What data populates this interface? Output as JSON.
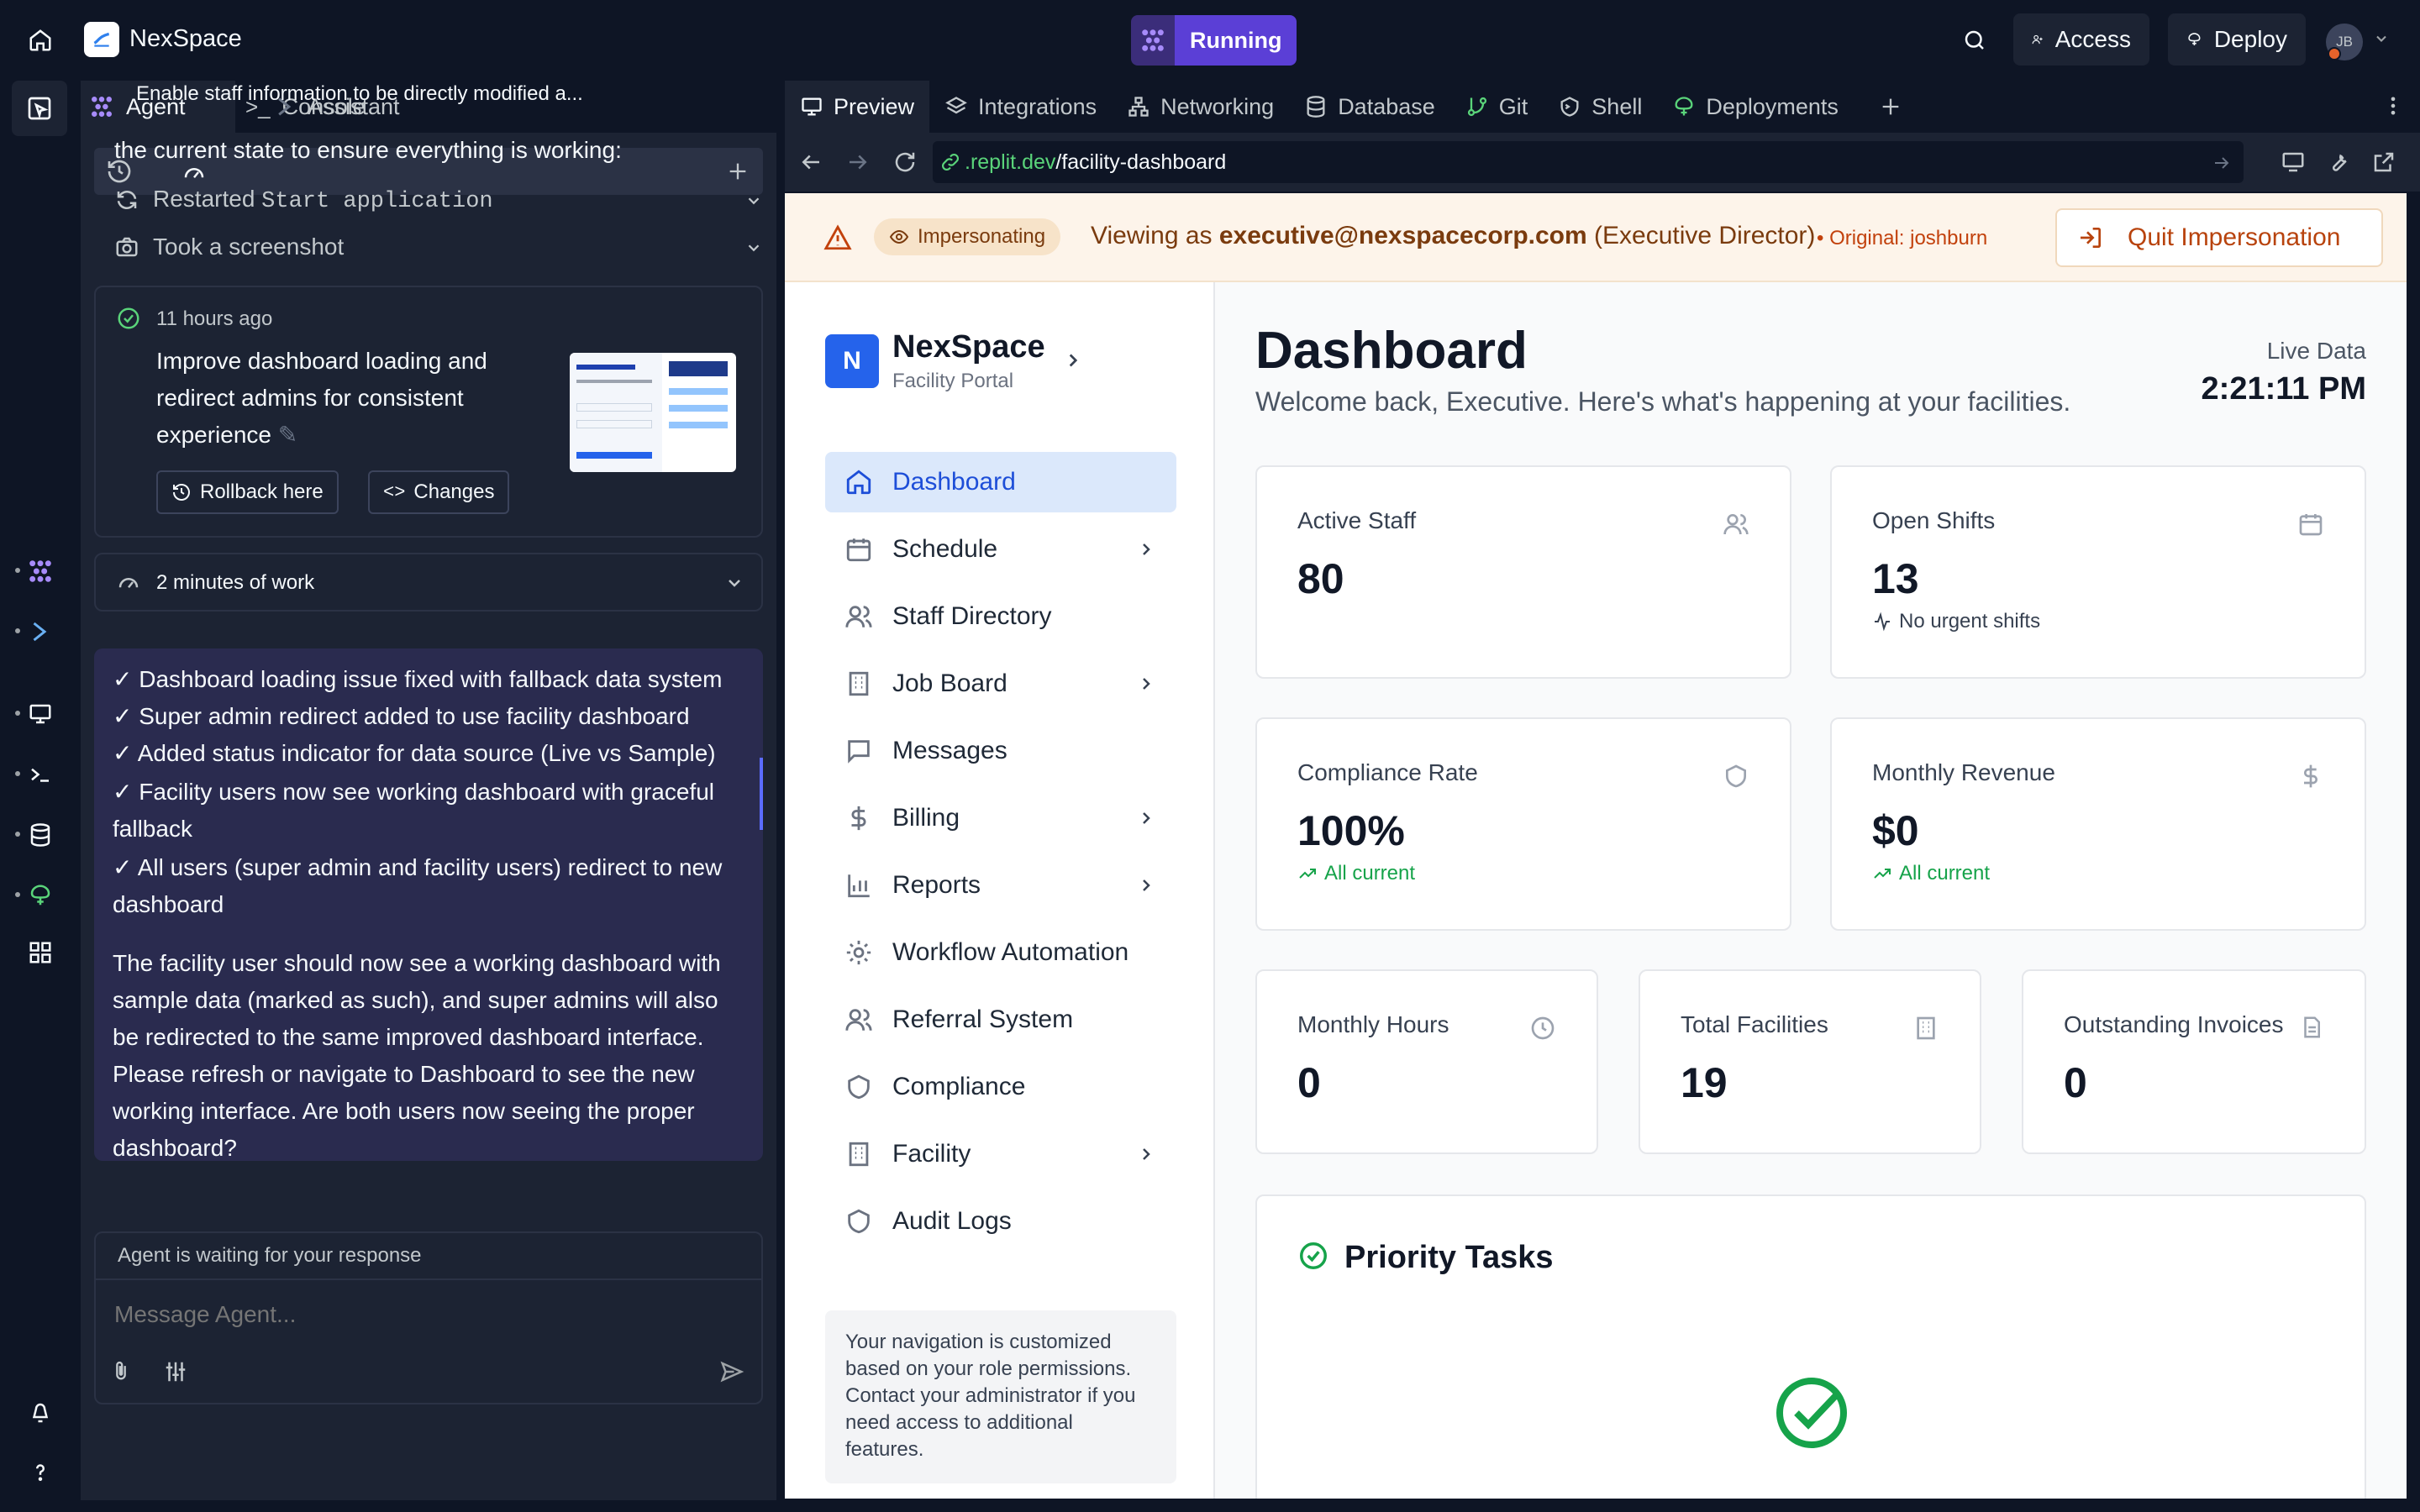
{
  "topbar": {
    "app_name": "NexSpace",
    "run_status": "Running",
    "access_label": "Access",
    "deploy_label": "Deploy",
    "avatar_initials": "JB"
  },
  "agent_tabs": [
    "Agent",
    "Console",
    "Assistant"
  ],
  "thread": {
    "title": "Enable staff information to be directly modified a..."
  },
  "chat": {
    "intro": "the current state to ensure everything is working:",
    "action1_prefix": "Restarted ",
    "action1_code": "Start application",
    "action2": "Took a screenshot"
  },
  "checkpoint": {
    "time": "11 hours ago",
    "title_lines": [
      "Improve dashboard loading and",
      "redirect admins for consistent",
      "experience"
    ],
    "rollback_label": "Rollback here",
    "changes_label": "Changes"
  },
  "work": {
    "label": "2 minutes of work"
  },
  "message": {
    "lines": [
      "✓ Dashboard loading issue fixed with fallback data system",
      "✓ Super admin redirect added to use facility dashboard",
      "✓ Added status indicator for data source (Live vs Sample)",
      "✓ Facility users now see working dashboard with graceful",
      "fallback",
      "✓ All users (super admin and facility users) redirect to new",
      "dashboard",
      "The facility user should now see a working dashboard with",
      "sample data (marked as such), and super admins will also",
      "be redirected to the same improved dashboard interface.",
      "Please refresh or navigate to Dashboard to see the new",
      "working interface. Are both users now seeing the proper",
      "dashboard?"
    ]
  },
  "input": {
    "status": "Agent is waiting for your response",
    "placeholder": "Message Agent..."
  },
  "workspace_tabs": [
    "Preview",
    "Integrations",
    "Networking",
    "Database",
    "Git",
    "Shell",
    "Deployments"
  ],
  "url": {
    "domain": ".replit.dev",
    "path": "/facility-dashboard"
  },
  "impersonation": {
    "badge": "Impersonating",
    "viewing_prefix": "Viewing as ",
    "email": "executive@nexspacecorp.com",
    "role": " (Executive Director)",
    "original": "• Original: joshburn",
    "quit_label": "Quit Impersonation"
  },
  "brand": {
    "letter": "N",
    "name": "NexSpace",
    "subtitle": "Facility Portal"
  },
  "nav": [
    {
      "label": "Dashboard",
      "icon": "home-icon",
      "arrow": false
    },
    {
      "label": "Schedule",
      "icon": "calendar-icon",
      "arrow": true
    },
    {
      "label": "Staff Directory",
      "icon": "users-icon",
      "arrow": false
    },
    {
      "label": "Job Board",
      "icon": "building-icon",
      "arrow": true
    },
    {
      "label": "Messages",
      "icon": "message-icon",
      "arrow": false
    },
    {
      "label": "Billing",
      "icon": "dollar-icon",
      "arrow": true
    },
    {
      "label": "Reports",
      "icon": "bar-chart-icon",
      "arrow": true
    },
    {
      "label": "Workflow Automation",
      "icon": "gear-icon",
      "arrow": false
    },
    {
      "label": "Referral System",
      "icon": "users-icon",
      "arrow": false
    },
    {
      "label": "Compliance",
      "icon": "shield-icon",
      "arrow": false
    },
    {
      "label": "Facility",
      "icon": "building-icon",
      "arrow": true
    },
    {
      "label": "Audit Logs",
      "icon": "shield-icon",
      "arrow": false
    }
  ],
  "nav_note": "Your navigation is customized based on your role permissions. Contact your administrator if you need access to additional features.",
  "dashboard": {
    "title": "Dashboard",
    "subtitle": "Welcome back, Executive. Here's what's happening at your facilities.",
    "live_label": "Live Data",
    "time": "2:21:11 PM"
  },
  "stats": {
    "active_staff": {
      "label": "Active Staff",
      "value": "80"
    },
    "open_shifts": {
      "label": "Open Shifts",
      "value": "13",
      "sub": "No urgent shifts"
    },
    "compliance": {
      "label": "Compliance Rate",
      "value": "100%",
      "sub": "All current"
    },
    "revenue": {
      "label": "Monthly Revenue",
      "value": "$0",
      "sub": "All current"
    },
    "hours": {
      "label": "Monthly Hours",
      "value": "0"
    },
    "facilities": {
      "label": "Total Facilities",
      "value": "19"
    },
    "invoices": {
      "label": "Outstanding Invoices",
      "value": "0"
    }
  },
  "priority": {
    "title": "Priority Tasks"
  },
  "colors": {
    "accent_purple": "#5b3fd6",
    "link_blue": "#1d4ed8",
    "success_green": "#16a34a",
    "warning_orange": "#c2410c"
  }
}
